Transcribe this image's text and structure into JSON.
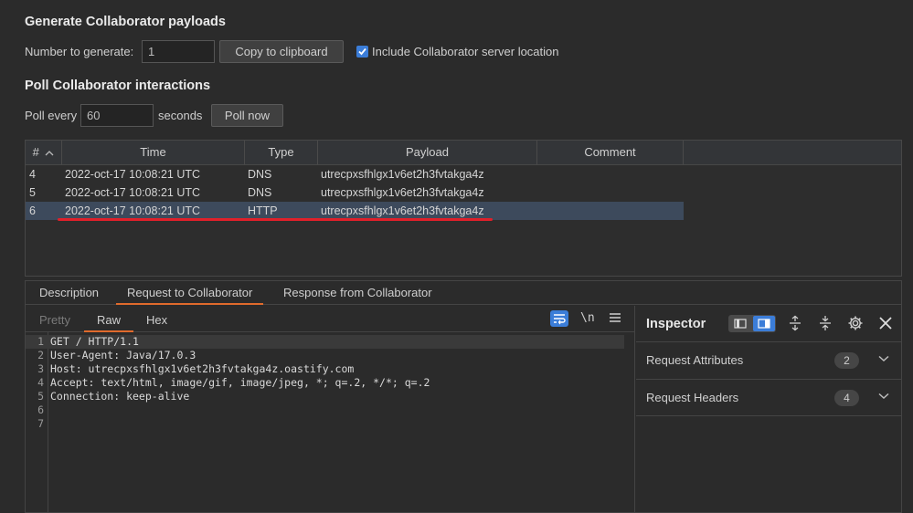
{
  "generate": {
    "title": "Generate Collaborator payloads",
    "number_label": "Number to generate:",
    "number_value": "1",
    "copy_button": "Copy to clipboard",
    "include_label": "Include Collaborator server location",
    "include_checked": true
  },
  "poll": {
    "title": "Poll Collaborator interactions",
    "every_label": "Poll every",
    "every_value": "60",
    "seconds_label": "seconds",
    "poll_button": "Poll now"
  },
  "table": {
    "columns": [
      "#",
      "Time",
      "Type",
      "Payload",
      "Comment"
    ],
    "rows": [
      {
        "num": "4",
        "time": "2022-oct-17 10:08:21 UTC",
        "type": "DNS",
        "payload": "utrecpxsfhlgx1v6et2h3fvtakga4z",
        "comment": ""
      },
      {
        "num": "5",
        "time": "2022-oct-17 10:08:21 UTC",
        "type": "DNS",
        "payload": "utrecpxsfhlgx1v6et2h3fvtakga4z",
        "comment": ""
      },
      {
        "num": "6",
        "time": "2022-oct-17 10:08:21 UTC",
        "type": "HTTP",
        "payload": "utrecpxsfhlgx1v6et2h3fvtakga4z",
        "comment": ""
      }
    ],
    "selected_row": 2
  },
  "detail_tabs": [
    "Description",
    "Request to Collaborator",
    "Response from Collaborator"
  ],
  "editor": {
    "tabs": [
      "Pretty",
      "Raw",
      "Hex"
    ],
    "newline_toggle": "\\n",
    "lines": [
      "GET / HTTP/1.1",
      "User-Agent: Java/17.0.3",
      "Host: utrecpxsfhlgx1v6et2h3fvtakga4z.oastify.com",
      "Accept: text/html, image/gif, image/jpeg, *; q=.2, */*; q=.2",
      "Connection: keep-alive",
      "",
      ""
    ],
    "line_numbers": [
      "1",
      "2",
      "3",
      "4",
      "5",
      "6",
      "7"
    ]
  },
  "inspector": {
    "title": "Inspector",
    "sections": [
      {
        "label": "Request Attributes",
        "count": "2"
      },
      {
        "label": "Request Headers",
        "count": "4"
      }
    ]
  },
  "colors": {
    "accent_tab": "#e06a2c",
    "selected_row": "#3d4a5c",
    "annotation": "#e0202a",
    "checkbox": "#3b7dd8"
  }
}
